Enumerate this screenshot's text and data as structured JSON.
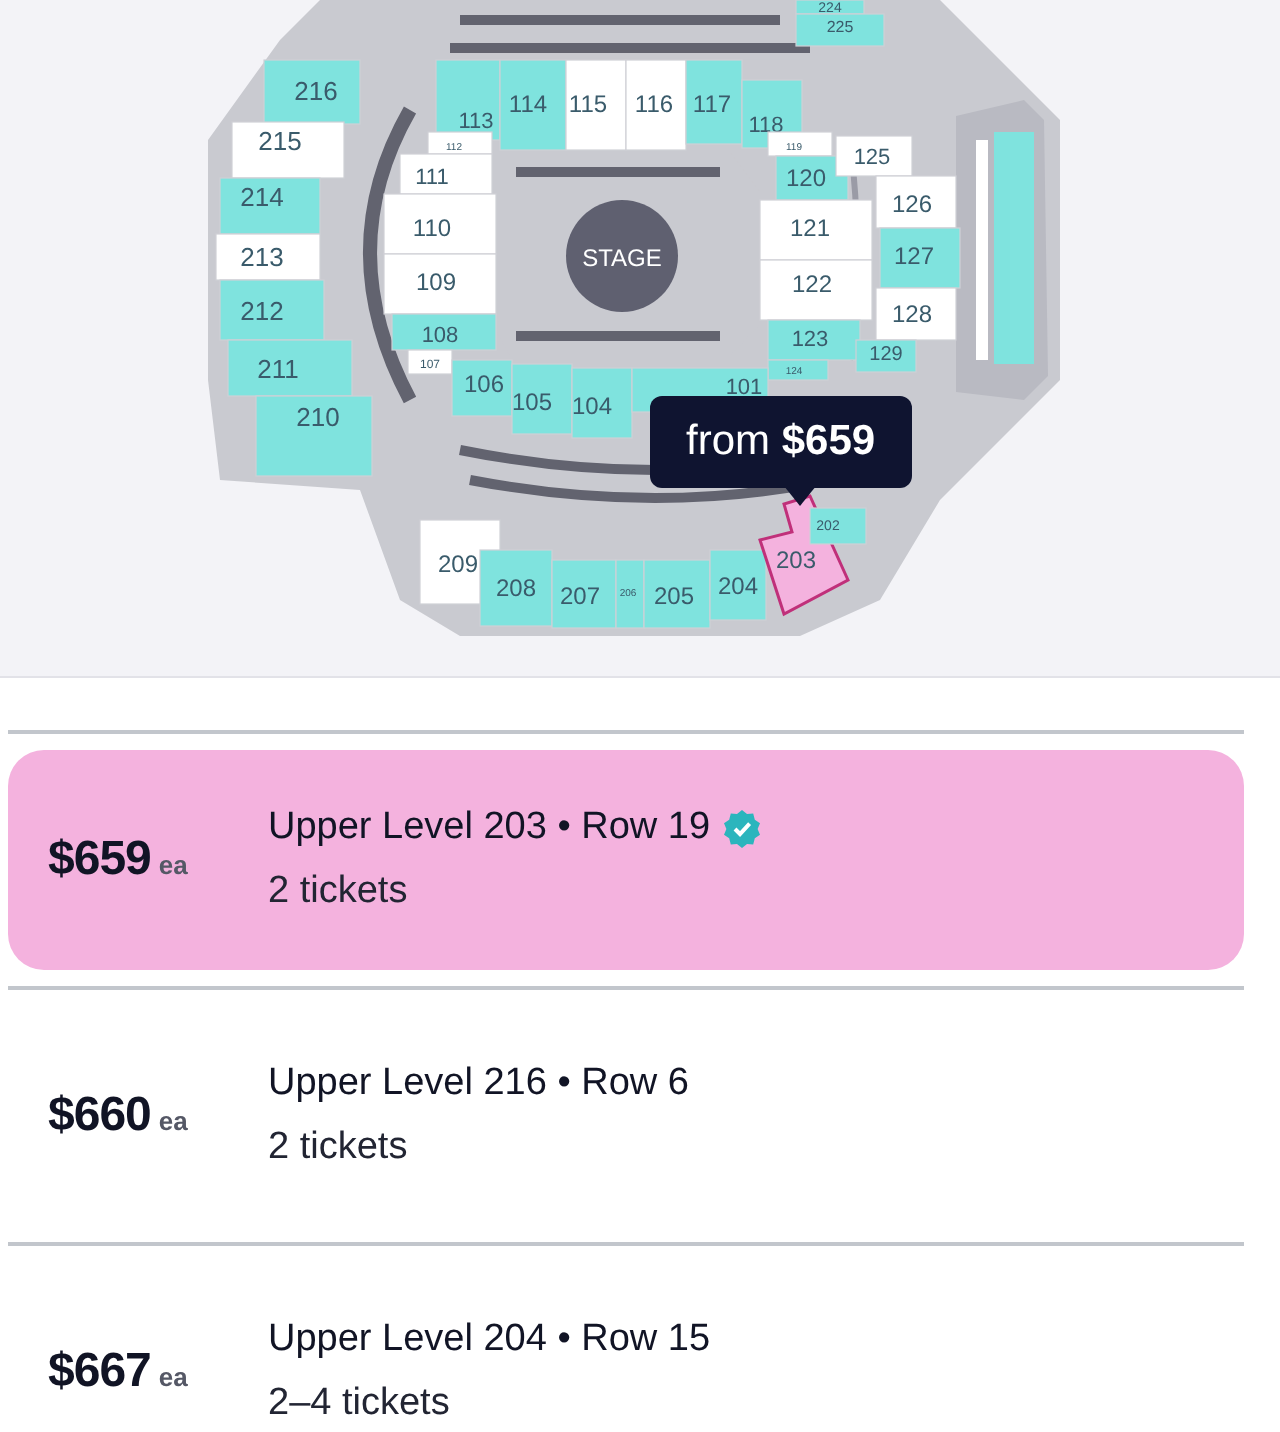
{
  "map": {
    "stage": "STAGE",
    "sections": [
      {
        "label": "224",
        "available": true,
        "selected": false
      },
      {
        "label": "225",
        "available": true,
        "selected": false
      },
      {
        "label": "216",
        "available": true,
        "selected": false
      },
      {
        "label": "215",
        "available": false,
        "selected": false
      },
      {
        "label": "214",
        "available": true,
        "selected": false
      },
      {
        "label": "213",
        "available": false,
        "selected": false
      },
      {
        "label": "212",
        "available": true,
        "selected": false
      },
      {
        "label": "211",
        "available": true,
        "selected": false
      },
      {
        "label": "210",
        "available": true,
        "selected": false
      },
      {
        "label": "113",
        "available": true,
        "selected": false
      },
      {
        "label": "114",
        "available": true,
        "selected": false
      },
      {
        "label": "115",
        "available": false,
        "selected": false
      },
      {
        "label": "116",
        "available": false,
        "selected": false
      },
      {
        "label": "117",
        "available": true,
        "selected": false
      },
      {
        "label": "118",
        "available": true,
        "selected": false
      },
      {
        "label": "112",
        "available": false,
        "selected": false
      },
      {
        "label": "111",
        "available": false,
        "selected": false
      },
      {
        "label": "110",
        "available": false,
        "selected": false
      },
      {
        "label": "109",
        "available": false,
        "selected": false
      },
      {
        "label": "108",
        "available": true,
        "selected": false
      },
      {
        "label": "107",
        "available": false,
        "selected": false
      },
      {
        "label": "106",
        "available": true,
        "selected": false
      },
      {
        "label": "105",
        "available": true,
        "selected": false
      },
      {
        "label": "104",
        "available": true,
        "selected": false
      },
      {
        "label": "119",
        "available": false,
        "selected": false
      },
      {
        "label": "120",
        "available": true,
        "selected": false
      },
      {
        "label": "121",
        "available": false,
        "selected": false
      },
      {
        "label": "122",
        "available": false,
        "selected": false
      },
      {
        "label": "123",
        "available": true,
        "selected": false
      },
      {
        "label": "124",
        "available": true,
        "selected": false
      },
      {
        "label": "101",
        "available": true,
        "selected": false
      },
      {
        "label": "125",
        "available": false,
        "selected": false
      },
      {
        "label": "126",
        "available": false,
        "selected": false
      },
      {
        "label": "127",
        "available": true,
        "selected": false
      },
      {
        "label": "128",
        "available": false,
        "selected": false
      },
      {
        "label": "129",
        "available": true,
        "selected": false
      },
      {
        "label": "209",
        "available": false,
        "selected": false
      },
      {
        "label": "208",
        "available": true,
        "selected": false
      },
      {
        "label": "207",
        "available": true,
        "selected": false
      },
      {
        "label": "206",
        "available": true,
        "selected": false
      },
      {
        "label": "205",
        "available": true,
        "selected": false
      },
      {
        "label": "204",
        "available": true,
        "selected": false
      },
      {
        "label": "203",
        "available": true,
        "selected": true
      },
      {
        "label": "202",
        "available": true,
        "selected": false
      }
    ],
    "tooltip": "from **$659**"
  },
  "listings": [
    {
      "price": "$659",
      "unit": "ea",
      "title": "Upper Level 203 • Row 19",
      "verified": true,
      "tickets": "2 tickets",
      "selected": true
    },
    {
      "price": "$660",
      "unit": "ea",
      "title": "Upper Level 216 • Row 6",
      "verified": false,
      "tickets": "2 tickets",
      "selected": false
    },
    {
      "price": "$667",
      "unit": "ea",
      "title": "Upper Level 204 • Row 15",
      "verified": false,
      "tickets": "2–4 tickets",
      "selected": false
    }
  ]
}
